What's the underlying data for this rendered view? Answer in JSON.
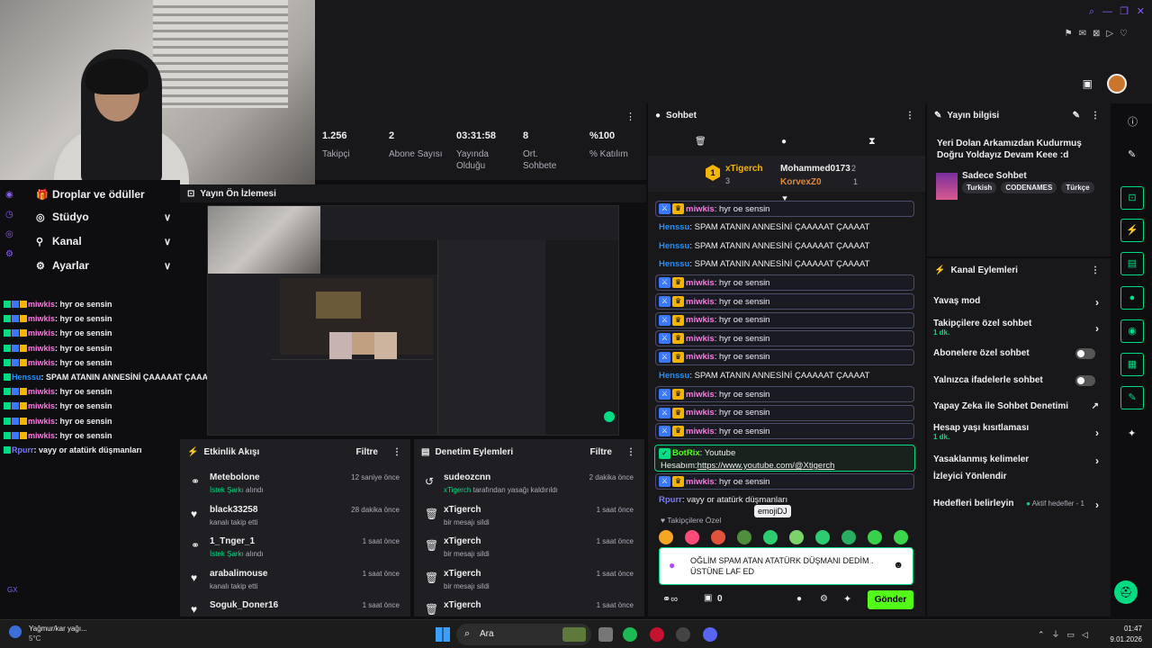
{
  "stats": [
    {
      "value": "1.256",
      "label": "Takipçi"
    },
    {
      "value": "2",
      "label": "Abone Sayısı"
    },
    {
      "value": "03:31:58",
      "label": "Yayında Olduğu"
    },
    {
      "value": "8",
      "label": "Ort. Sohbete"
    },
    {
      "value": "%100",
      "label": "% Katılım"
    }
  ],
  "menu": {
    "drops": "Droplar ve ödüller",
    "studio": "Stüdyo",
    "channel": "Kanal",
    "settings": "Ayarlar"
  },
  "left_chat": [
    {
      "user": "miwkis",
      "text": ": hyr oe sensin"
    },
    {
      "user": "miwkis",
      "text": ": hyr oe sensin"
    },
    {
      "user": "miwkis",
      "text": ": hyr oe sensin"
    },
    {
      "user": "miwkis",
      "text": ": hyr oe sensin"
    },
    {
      "user": "miwkis",
      "text": ": hyr oe sensin"
    },
    {
      "user": "Henssu",
      "text": ": SPAM ATANIN ANNESİNİ ÇAAAAAT ÇAAAAT"
    },
    {
      "user": "miwkis",
      "text": ": hyr oe sensin"
    },
    {
      "user": "miwkis",
      "text": ": hyr oe sensin"
    },
    {
      "user": "miwkis",
      "text": ": hyr oe sensin"
    },
    {
      "user": "miwkis",
      "text": ": hyr oe sensin"
    },
    {
      "user": "Rpurr",
      "text": ": vayy or atatürk düşmanları"
    }
  ],
  "preview": {
    "title": "Yayın Ön İzlemesi"
  },
  "activity": {
    "title": "Etkinlik Akışı",
    "filter": "Filtre",
    "items": [
      {
        "name": "Metebolone",
        "sub_green": "İstek Şarkı",
        "sub": " alındı",
        "time": "12 saniye önce"
      },
      {
        "name": "black33258",
        "sub_green": "",
        "sub": "kanalı takip etti",
        "time": "28 dakika önce"
      },
      {
        "name": "1_Tnger_1",
        "sub_green": "İstek Şarkı",
        "sub": " alındı",
        "time": "1 saat önce"
      },
      {
        "name": "arabalimouse",
        "sub_green": "",
        "sub": "kanalı takip etti",
        "time": "1 saat önce"
      },
      {
        "name": "Soguk_Doner16",
        "sub_green": "",
        "sub": "",
        "time": "1 saat önce"
      }
    ]
  },
  "mod": {
    "title": "Denetim Eylemleri",
    "filter": "Filtre",
    "items": [
      {
        "name": "sudeozcnn",
        "sub_green": "xTigerch",
        "sub": " tarafından yasağı kaldırıldı",
        "time": "2 dakika önce"
      },
      {
        "name": "xTigerch",
        "sub_green": "",
        "sub": "bir mesajı sildi",
        "time": "1 saat önce"
      },
      {
        "name": "xTigerch",
        "sub_green": "",
        "sub": "bir mesajı sildi",
        "time": "1 saat önce"
      },
      {
        "name": "xTigerch",
        "sub_green": "",
        "sub": "bir mesajı sildi",
        "time": "1 saat önce"
      },
      {
        "name": "xTigerch",
        "sub_green": "",
        "sub": "",
        "time": "1 saat önce"
      }
    ]
  },
  "chat": {
    "title": "Sohbet",
    "leaders": {
      "first": "xTigerch",
      "first_count": "3",
      "second": "Mohammed0173",
      "second_count": "2",
      "third": "KorvexZ0",
      "third_count": "1"
    },
    "messages": [
      {
        "user": "miwkis",
        "text": ": hyr oe sensin",
        "box": true,
        "color": "#ff75e6"
      },
      {
        "user": "Henssu",
        "text": ": SPAM ATANIN ANNESİNİ ÇAAAAAT ÇAAAAT",
        "box": false,
        "color": "#1e90ff"
      },
      {
        "user": "Henssu",
        "text": ": SPAM ATANIN ANNESİNİ ÇAAAAAT ÇAAAAT",
        "box": false,
        "color": "#1e90ff"
      },
      {
        "user": "Henssu",
        "text": ": SPAM ATANIN ANNESİNİ ÇAAAAAT ÇAAAAT",
        "box": false,
        "color": "#1e90ff"
      },
      {
        "user": "miwkis",
        "text": ": hyr oe sensin",
        "box": true,
        "color": "#ff75e6"
      },
      {
        "user": "miwkis",
        "text": ": hyr oe sensin",
        "box": true,
        "color": "#ff75e6"
      },
      {
        "user": "miwkis",
        "text": ": hyr oe sensin",
        "box": true,
        "color": "#ff75e6"
      },
      {
        "user": "miwkis",
        "text": ": hyr oe sensin",
        "box": true,
        "color": "#ff75e6"
      },
      {
        "user": "miwkis",
        "text": ": hyr oe sensin",
        "box": true,
        "color": "#ff75e6"
      },
      {
        "user": "Henssu",
        "text": ": SPAM ATANIN ANNESİNİ ÇAAAAAT ÇAAAAT",
        "box": false,
        "color": "#1e90ff"
      },
      {
        "user": "miwkis",
        "text": ": hyr oe sensin",
        "box": true,
        "color": "#ff75e6"
      },
      {
        "user": "miwkis",
        "text": ": hyr oe sensin",
        "box": true,
        "color": "#ff75e6"
      },
      {
        "user": "miwkis",
        "text": ": hyr oe sensin",
        "box": true,
        "color": "#ff75e6"
      }
    ],
    "bot": {
      "user": "BotRix",
      "text": ": Youtube",
      "line2": "Hesabım:",
      "link": "https://www.youtube.com/@Xtigerch"
    },
    "after": [
      {
        "user": "miwkis",
        "text": ": hyr oe sensin",
        "box": true,
        "color": "#ff75e6"
      },
      {
        "user": "Rpurr",
        "text": ": vayy or atatürk düşmanları",
        "box": false,
        "color": "#7a7aff"
      }
    ],
    "followers_only": "Takipçilere Özel",
    "tooltip": "emojiDJ",
    "input_text": "OĞLİM SPAM ATAN ATATÜRK DÜŞMANI DEDİM . ÜSTÜNE LAF ED",
    "points": "0",
    "send": "Gönder"
  },
  "info": {
    "title": "Yayın bilgisi",
    "stream_title": "Yeri Dolan Arkamızdan Kudurmuş Doğru Yoldayız Devam Keee :d",
    "category": "Sadece Sohbet",
    "tags": [
      "Turkish",
      "CODENAMES",
      "Türkçe"
    ]
  },
  "actions": {
    "title": "Kanal Eylemleri",
    "items": [
      {
        "label": "Yavaş mod",
        "sub": "",
        "kind": "chev"
      },
      {
        "label": "Takipçilere özel sohbet",
        "sub": "1 dk.",
        "kind": "chev"
      },
      {
        "label": "Abonelere özel sohbet",
        "sub": "",
        "kind": "toggle"
      },
      {
        "label": "Yalnızca ifadelerle sohbet",
        "sub": "",
        "kind": "toggle"
      },
      {
        "label": "Yapay Zeka ile Sohbet Denetimi",
        "sub": "",
        "kind": "ext"
      },
      {
        "label": "Hesap yaşı kısıtlaması",
        "sub": "1 dk.",
        "kind": "chev"
      },
      {
        "label": "Yasaklanmış kelimeler",
        "sub": "",
        "kind": "chev"
      },
      {
        "label": "İzleyici Yönlendir",
        "sub": "",
        "kind": "none"
      },
      {
        "label": "Hedefleri belirleyin",
        "sub": "",
        "kind": "goal"
      }
    ],
    "goal_status": "Aktif hedefler - 1"
  },
  "taskbar": {
    "weather_title": "Yağmur/kar yağı...",
    "weather_temp": "5°C",
    "search": "Ara",
    "time": "01:47",
    "date": "9.01.2026"
  },
  "left_gx": "GX"
}
